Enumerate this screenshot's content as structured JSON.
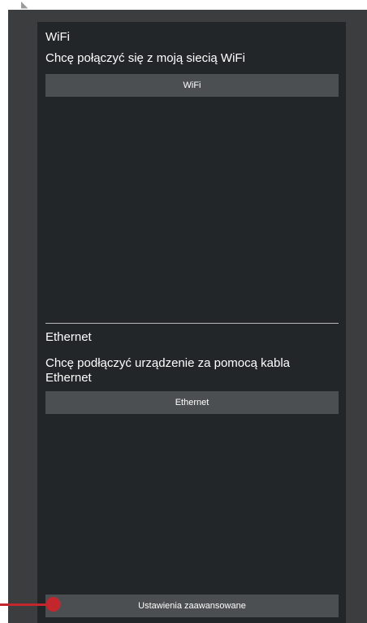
{
  "wifi_section": {
    "title": "WiFi",
    "description": "Chcę połączyć się z moją siecią WiFi",
    "button_label": "WiFi"
  },
  "ethernet_section": {
    "title": "Ethernet",
    "description_line1": "Chcę podłączyć urządzenie za pomocą kabla",
    "description_line2": "Ethernet",
    "button_label": "Ethernet"
  },
  "footer": {
    "advanced_button_label": "Ustawienia zaawansowane"
  },
  "colors": {
    "panel_background": "#222628",
    "window_background": "#3b3d3f",
    "button_background": "#4b4f51",
    "callout_marker": "#c4262e"
  }
}
